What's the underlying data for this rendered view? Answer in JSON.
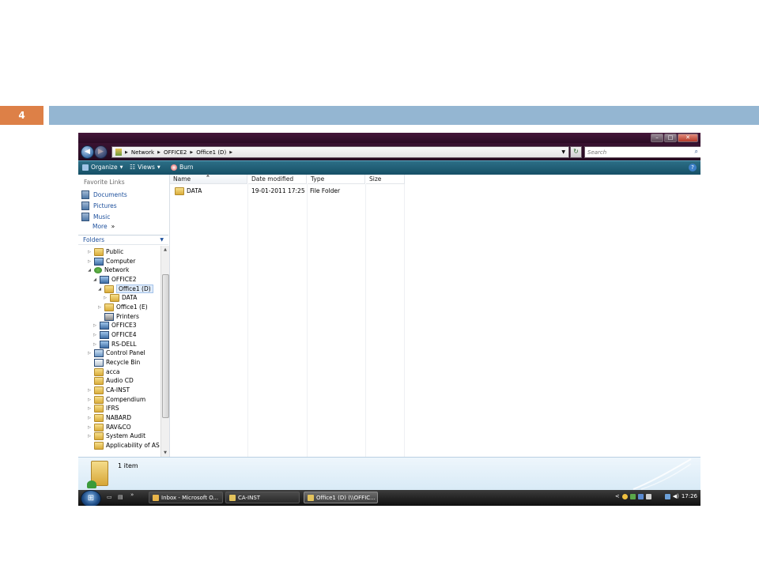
{
  "slide": {
    "number": "4"
  },
  "window": {
    "breadcrumb": [
      "Network",
      "OFFICE2",
      "Office1 (D)"
    ],
    "search_placeholder": "Search",
    "toolbar": {
      "organize": "Organize",
      "views": "Views",
      "burn": "Burn"
    }
  },
  "left_pane": {
    "favorites_title": "Favorite Links",
    "favorites": [
      "Documents",
      "Pictures",
      "Music"
    ],
    "more_label": "More",
    "folders_title": "Folders",
    "tree": [
      "Public",
      "Computer",
      "Network",
      "OFFICE2",
      "Office1 (D)",
      "DATA",
      "Office1 (E)",
      "Printers",
      "OFFICE3",
      "OFFICE4",
      "RS-DELL",
      "Control Panel",
      "Recycle Bin",
      "acca",
      "Audio CD",
      "CA-INST",
      "Compendium",
      "IFRS",
      "NABARD",
      "RAV&CO",
      "System Audit",
      "Applicability of AS and"
    ]
  },
  "file_list": {
    "columns": [
      "Name",
      "Date modified",
      "Type",
      "Size"
    ],
    "rows": [
      {
        "name": "DATA",
        "date": "19-01-2011 17:25",
        "type": "File Folder",
        "size": ""
      }
    ]
  },
  "details": {
    "item_count": "1 item"
  },
  "taskbar": {
    "tasks": [
      "Inbox - Microsoft O...",
      "CA-INST",
      "Office1 (D) (\\\\OFFIC..."
    ],
    "clock": "17:26"
  },
  "colors": {
    "slide_accent": "#dd8047",
    "slide_bar": "#94b6d2",
    "titlebar": "#2b0c25",
    "toolbar": "#165066",
    "link": "#1c4f9c"
  }
}
